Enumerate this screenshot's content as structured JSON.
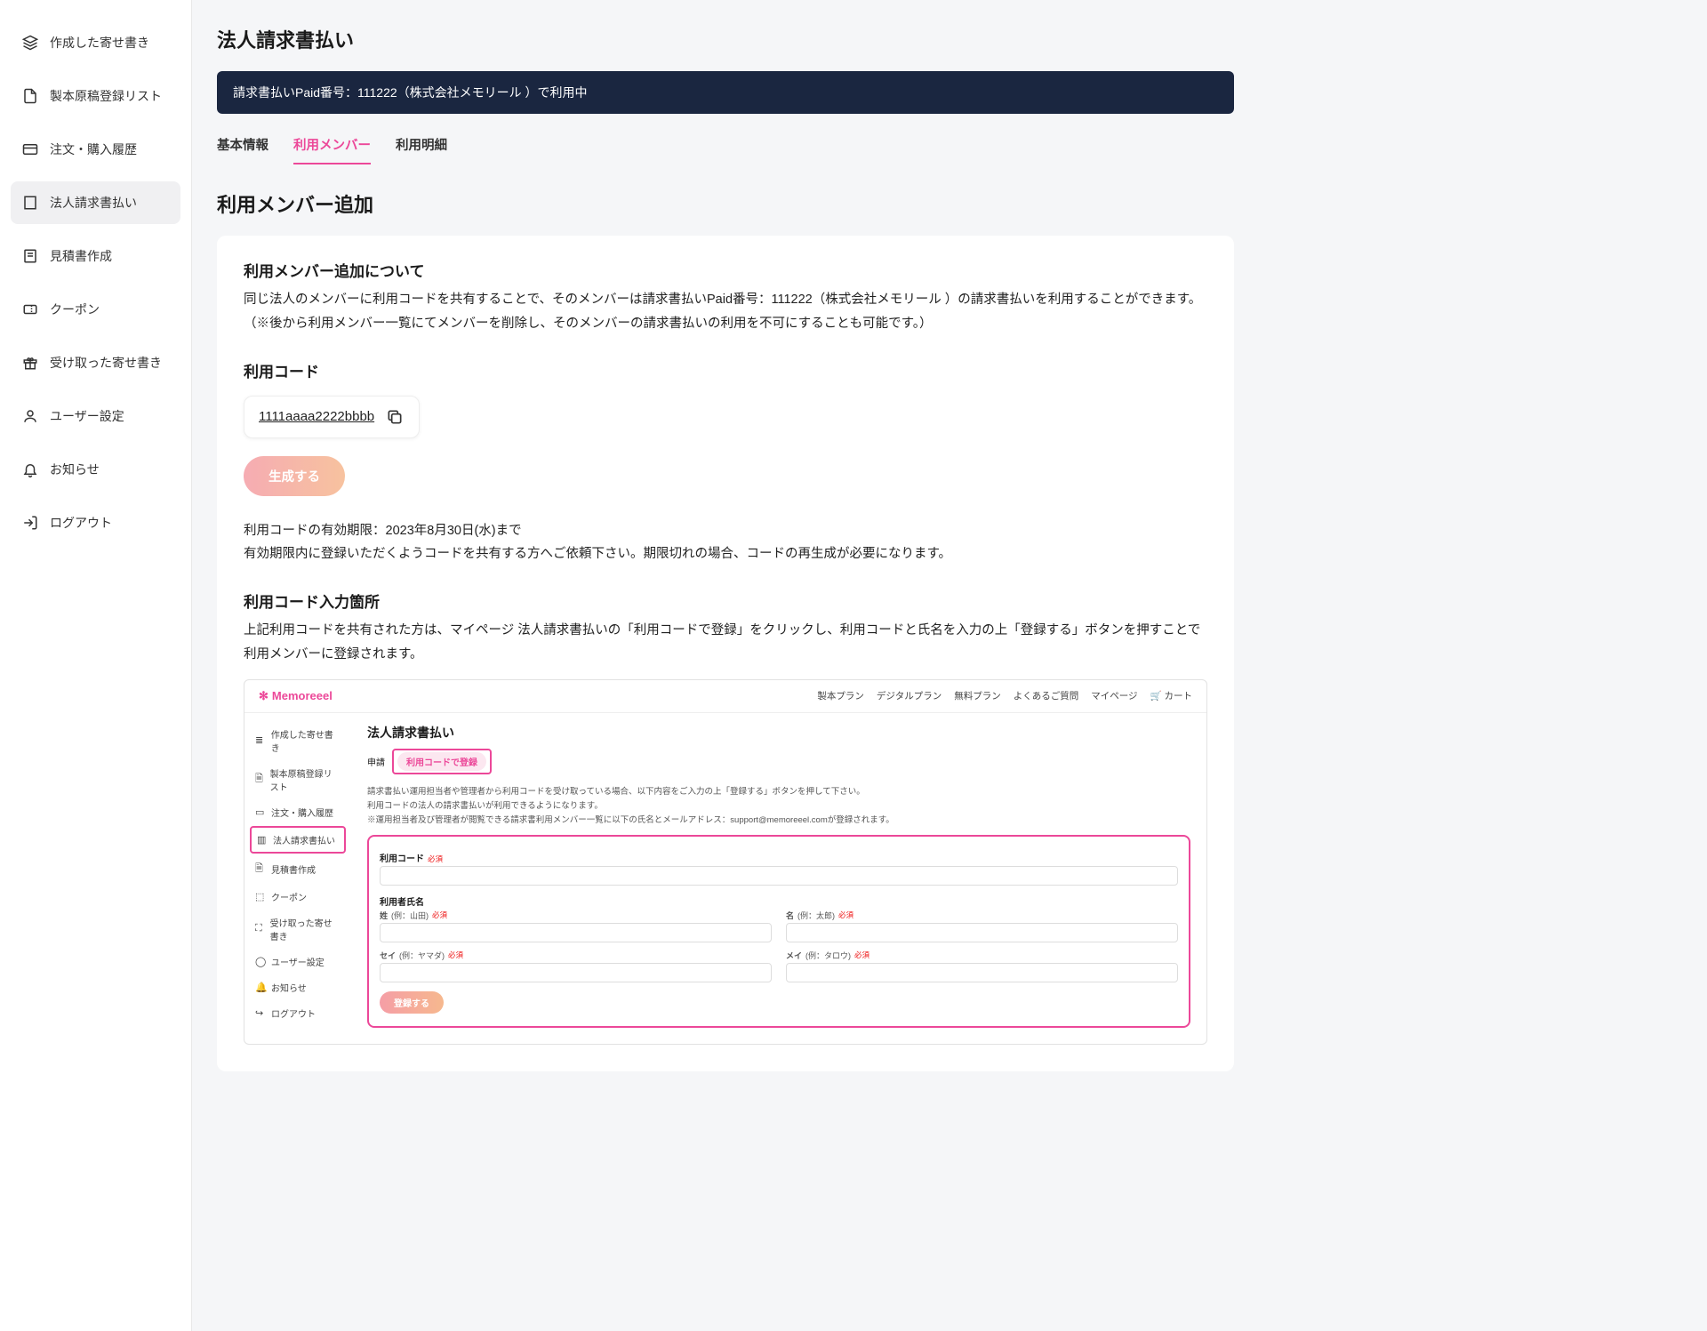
{
  "sidebar": {
    "items": [
      {
        "label": "作成した寄せ書き"
      },
      {
        "label": "製本原稿登録リスト"
      },
      {
        "label": "注文・購入履歴"
      },
      {
        "label": "法人請求書払い"
      },
      {
        "label": "見積書作成"
      },
      {
        "label": "クーポン"
      },
      {
        "label": "受け取った寄せ書き"
      },
      {
        "label": "ユーザー設定"
      },
      {
        "label": "お知らせ"
      },
      {
        "label": "ログアウト"
      }
    ],
    "active_index": 3
  },
  "page": {
    "title": "法人請求書払い",
    "banner": "請求書払いPaid番号：111222（株式会社メモリール ）で利用中",
    "tabs": [
      "基本情報",
      "利用メンバー",
      "利用明細"
    ],
    "active_tab": 1,
    "section_title": "利用メンバー追加"
  },
  "about": {
    "heading": "利用メンバー追加について",
    "line1": "同じ法人のメンバーに利用コードを共有することで、そのメンバーは請求書払いPaid番号：111222（株式会社メモリール ）の請求書払いを利用することができます。",
    "line2": "（※後から利用メンバー一覧にてメンバーを削除し、そのメンバーの請求書払いの利用を不可にすることも可能です。）"
  },
  "code": {
    "heading": "利用コード",
    "value": "1111aaaa2222bbbb",
    "generate_button": "生成する",
    "expiry_line": "利用コードの有効期限：2023年8月30日(水)まで",
    "expiry_note": "有効期限内に登録いただくようコードを共有する方へご依頼下さい。期限切れの場合、コードの再生成が必要になります。"
  },
  "input_location": {
    "heading": "利用コード入力箇所",
    "desc": "上記利用コードを共有された方は、マイページ 法人請求書払いの「利用コードで登録」をクリックし、利用コードと氏名を入力の上「登録する」ボタンを押すことで利用メンバーに登録されます。"
  },
  "mock": {
    "logo": "Memoreeel",
    "nav": [
      "製本プラン",
      "デジタルプラン",
      "無料プラン",
      "よくあるご質問",
      "マイページ",
      "カート"
    ],
    "sidebar": [
      "作成した寄せ書き",
      "製本原稿登録リスト",
      "注文・購入履歴",
      "法人請求書払い",
      "見積書作成",
      "クーポン",
      "受け取った寄せ書き",
      "ユーザー設定",
      "お知らせ",
      "ログアウト"
    ],
    "title": "法人請求書払い",
    "tab_apply": "申請",
    "tab_register": "利用コードで登録",
    "desc1": "請求書払い運用担当者や管理者から利用コードを受け取っている場合、以下内容をご入力の上「登録する」ボタンを押して下さい。",
    "desc2": "利用コードの法人の請求書払いが利用できるようになります。",
    "desc3": "※運用担当者及び管理者が閲覧できる請求書利用メンバー一覧に以下の氏名とメールアドレス：support@memoreeel.comが登録されます。",
    "field_code": "利用コード",
    "field_name_heading": "利用者氏名",
    "sei": "姓",
    "sei_ex": "(例：山田)",
    "mei": "名",
    "mei_ex": "(例：太郎)",
    "sei_kana": "セイ",
    "sei_kana_ex": "(例：ヤマダ)",
    "mei_kana": "メイ",
    "mei_kana_ex": "(例：タロウ)",
    "required": "必須",
    "submit": "登録する"
  }
}
